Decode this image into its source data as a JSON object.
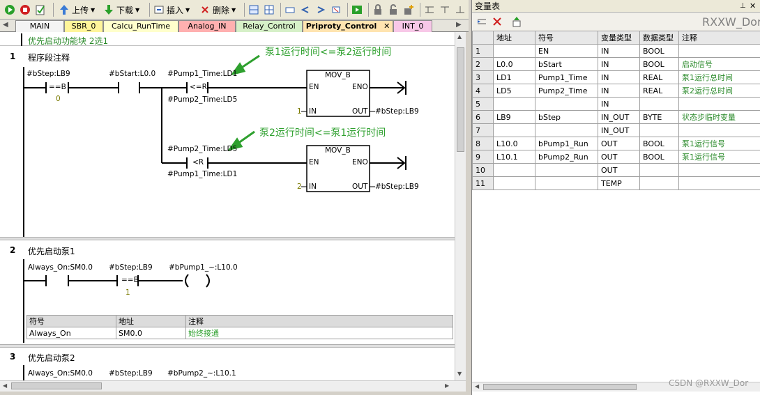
{
  "toolbar": {
    "upload_label": "上传",
    "download_label": "下载",
    "insert_label": "插入",
    "delete_label": "删除"
  },
  "tabs": [
    {
      "label": "MAIN",
      "color": "#f4f4f4"
    },
    {
      "label": "SBR_0",
      "color": "#fff59a"
    },
    {
      "label": "Calcu_RunTime",
      "color": "#ffffcc"
    },
    {
      "label": "Analog_IN",
      "color": "#ffb0b0"
    },
    {
      "label": "Relay_Control",
      "color": "#d6f0c8"
    },
    {
      "label": "Priproty_Control",
      "color": "#ffe4b0",
      "active": true
    },
    {
      "label": "INT_0",
      "color": "#f8c8e8"
    }
  ],
  "editor": {
    "block_comment": "优先启动功能块 2选1",
    "networks": [
      {
        "number": "1",
        "title": "程序段注释",
        "annotation_1": "泵1运行时间<=泵2运行时间",
        "annotation_2": "泵2运行时间<=泵1运行时间",
        "contact_1_label": "#bStep:LB9",
        "contact_1_op": "==B",
        "contact_1_value": "0",
        "contact_2_label": "#bStart:L0.0",
        "compare_1_top": "#Pump1_Time:LD1",
        "compare_1_op": "<=R",
        "compare_1_bottom": "#Pump2_Time:LD5",
        "compare_2_top": "#Pump2_Time:LD5",
        "compare_2_op": "<R",
        "compare_2_bottom": "#Pump1_Time:LD1",
        "box_1": {
          "name": "MOV_B",
          "en": "EN",
          "eno": "ENO",
          "in": "IN",
          "out": "OUT",
          "in_value": "1",
          "out_value": "#bStep:LB9"
        },
        "box_2": {
          "name": "MOV_B",
          "en": "EN",
          "eno": "ENO",
          "in": "IN",
          "out": "OUT",
          "in_value": "2",
          "out_value": "#bStep:LB9"
        }
      },
      {
        "number": "2",
        "title": "优先启动泵1",
        "contact_1_label": "Always_On:SM0.0",
        "contact_2_label": "#bStep:LB9",
        "contact_2_op": "==B",
        "contact_2_value": "1",
        "coil_label": "#bPump1_~:L10.0",
        "symbol_table": {
          "headers": [
            "符号",
            "地址",
            "注释"
          ],
          "row": [
            "Always_On",
            "SM0.0",
            "始终接通"
          ]
        }
      },
      {
        "number": "3",
        "title": "优先启动泵2",
        "contact_1_label": "Always_On:SM0.0",
        "contact_2_label": "#bStep:LB9",
        "coil_label": "#bPump2_~:L10.1"
      }
    ]
  },
  "var_panel": {
    "title": "变量表",
    "watermark": "RXXW_Dor",
    "headers": [
      "地址",
      "符号",
      "变量类型",
      "数据类型",
      "注释"
    ],
    "rows": [
      [
        "1",
        "",
        "EN",
        "IN",
        "BOOL",
        ""
      ],
      [
        "2",
        "L0.0",
        "bStart",
        "IN",
        "BOOL",
        "启动信号"
      ],
      [
        "3",
        "LD1",
        "Pump1_Time",
        "IN",
        "REAL",
        "泵1运行总时间"
      ],
      [
        "4",
        "LD5",
        "Pump2_Time",
        "IN",
        "REAL",
        "泵2运行总时间"
      ],
      [
        "5",
        "",
        "",
        "IN",
        "",
        ""
      ],
      [
        "6",
        "LB9",
        "bStep",
        "IN_OUT",
        "BYTE",
        "状态步临时变量"
      ],
      [
        "7",
        "",
        "",
        "IN_OUT",
        "",
        ""
      ],
      [
        "8",
        "L10.0",
        "bPump1_Run",
        "OUT",
        "BOOL",
        "泵1运行信号"
      ],
      [
        "9",
        "L10.1",
        "bPump2_Run",
        "OUT",
        "BOOL",
        "泵1运行信号"
      ],
      [
        "10",
        "",
        "",
        "OUT",
        "",
        ""
      ],
      [
        "11",
        "",
        "",
        "TEMP",
        "",
        ""
      ]
    ],
    "footer": "CSDN @RXXW_Dor"
  }
}
